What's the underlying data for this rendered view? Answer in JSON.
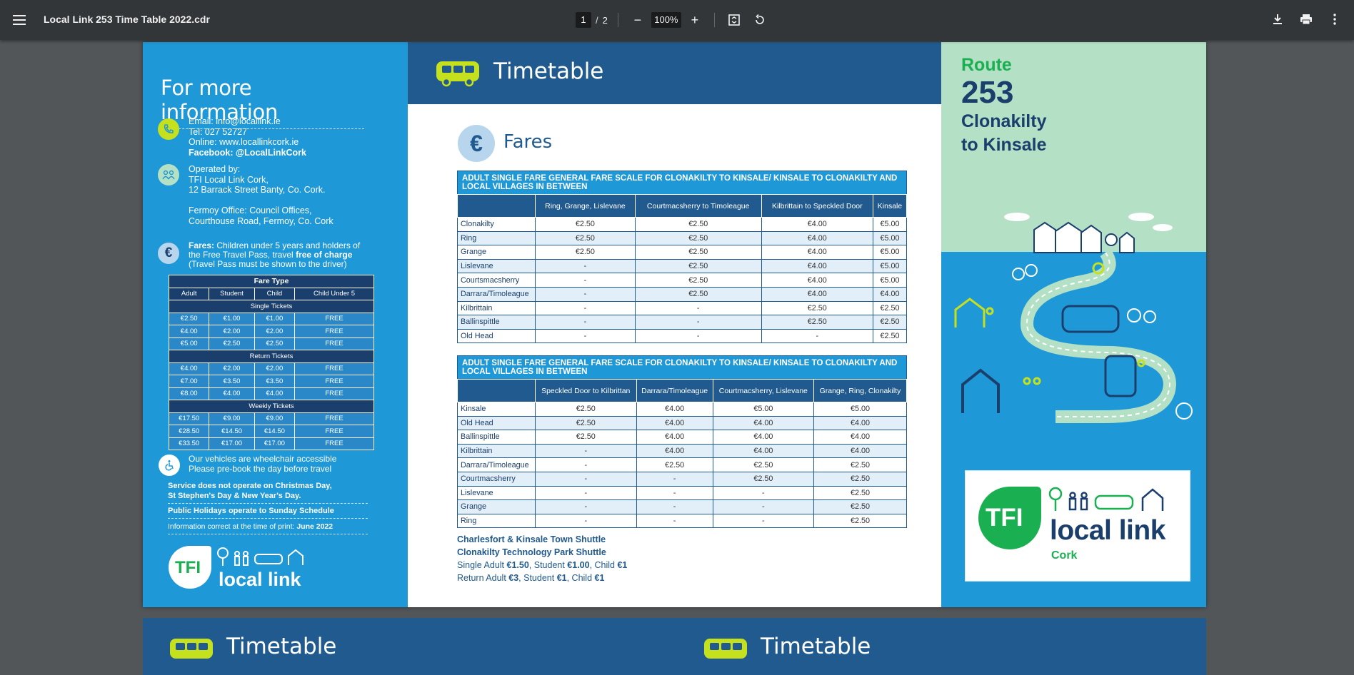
{
  "toolbar": {
    "title": "Local Link 253 Time Table 2022.cdr",
    "page_current": "1",
    "page_total": "2",
    "zoom": "100%"
  },
  "left": {
    "heading": "For more information",
    "contact": [
      "Email: info@locallink.ie",
      "Tel:  027 52727",
      "Online: www.locallinkcork.ie",
      "Facebook: @LocalLinkCork"
    ],
    "operated": [
      "Operated by:",
      "TFI Local Link Cork,",
      "12 Barrack Street Banty, Co. Cork.",
      "",
      "Fermoy Office: Council Offices,",
      "Courthouse Road, Fermoy, Co. Cork"
    ],
    "fares_label": "Fares:",
    "fares_text": " Children under 5 years and holders of the Free Travel Pass, travel ",
    "fares_bold": "free of charge",
    "fares_tail": " (Travel Pass must be shown to the driver)",
    "fare_type": "Fare Type",
    "fare_cols": [
      "Adult",
      "Student",
      "Child",
      "Child Under 5"
    ],
    "sections": [
      {
        "name": "Single Tickets",
        "rows": [
          [
            "€2.50",
            "€1.00",
            "€1.00",
            "FREE"
          ],
          [
            "€4.00",
            "€2.00",
            "€2.00",
            "FREE"
          ],
          [
            "€5.00",
            "€2.50",
            "€2.50",
            "FREE"
          ]
        ]
      },
      {
        "name": "Return Tickets",
        "rows": [
          [
            "€4.00",
            "€2.00",
            "€2.00",
            "FREE"
          ],
          [
            "€7.00",
            "€3.50",
            "€3.50",
            "FREE"
          ],
          [
            "€8.00",
            "€4.00",
            "€4.00",
            "FREE"
          ]
        ]
      },
      {
        "name": "Weekly Tickets",
        "rows": [
          [
            "€17.50",
            "€9.00",
            "€9.00",
            "FREE"
          ],
          [
            "€28.50",
            "€14.50",
            "€14.50",
            "FREE"
          ],
          [
            "€33.50",
            "€17.00",
            "€17.00",
            "FREE"
          ]
        ]
      }
    ],
    "wheelchair": [
      "Our vehicles are wheelchair accessible",
      "Please pre-book the day before travel"
    ],
    "note1": [
      "Service does not operate on Christmas Day,",
      "St Stephen's Day & New Year's Day."
    ],
    "note2": "Public Holidays operate to Sunday Schedule",
    "note3_pre": "Information correct at the time of print: ",
    "note3_bold": "June 2022",
    "logo_tfi": "TFI",
    "logo_text": "local link"
  },
  "main": {
    "header_title": "Timetable",
    "fares_title": "Fares",
    "euro_symbol": "€",
    "table1": {
      "title": "ADULT SINGLE FARE GENERAL FARE SCALE FOR CLONAKILTY TO KINSALE/ KINSALE TO CLONAKILTY AND LOCAL VILLAGES IN BETWEEN",
      "cols": [
        "Ring, Grange, Lislevane",
        "Courtmacsherry to Timoleague",
        "Kilbrittain to Speckled Door",
        "Kinsale"
      ],
      "rows": [
        [
          "Clonakilty",
          "€2.50",
          "€2.50",
          "€4.00",
          "€5.00"
        ],
        [
          "Ring",
          "€2.50",
          "€2.50",
          "€4.00",
          "€5.00"
        ],
        [
          "Grange",
          "€2.50",
          "€2.50",
          "€4.00",
          "€5.00"
        ],
        [
          "Lislevane",
          "-",
          "€2.50",
          "€4.00",
          "€5.00"
        ],
        [
          "Courtsmacsherry",
          "-",
          "€2.50",
          "€4.00",
          "€5.00"
        ],
        [
          "Darrara/Timoleague",
          "-",
          "€2.50",
          "€4.00",
          "€4.00"
        ],
        [
          "Kilbrittain",
          "-",
          "-",
          "€2.50",
          "€2.50"
        ],
        [
          "Ballinspittle",
          "-",
          "-",
          "€2.50",
          "€2.50"
        ],
        [
          "Old Head",
          "-",
          "-",
          "-",
          "€2.50"
        ]
      ]
    },
    "table2": {
      "title": "ADULT SINGLE FARE GENERAL FARE SCALE FOR CLONAKILTY TO KINSALE/ KINSALE TO CLONAKILTY AND LOCAL VILLAGES IN BETWEEN",
      "cols": [
        "Speckled Door to Kilbrittan",
        "Darrara/Timoleague",
        "Courtmacsherry, Lislevane",
        "Grange, Ring, Clonakilty"
      ],
      "rows": [
        [
          "Kinsale",
          "€2.50",
          "€4.00",
          "€5.00",
          "€5.00"
        ],
        [
          "Old Head",
          "€2.50",
          "€4.00",
          "€4.00",
          "€4.00"
        ],
        [
          "Ballinspittle",
          "€2.50",
          "€4.00",
          "€4.00",
          "€4.00"
        ],
        [
          "Kilbrittain",
          "-",
          "€4.00",
          "€4.00",
          "€4.00"
        ],
        [
          "Darrara/Timoleague",
          "-",
          "€2.50",
          "€2.50",
          "€2.50"
        ],
        [
          "Courtmacsherry",
          "-",
          "-",
          "€2.50",
          "€2.50"
        ],
        [
          "Lislevane",
          "-",
          "-",
          "-",
          "€2.50"
        ],
        [
          "Grange",
          "-",
          "-",
          "-",
          "€2.50"
        ],
        [
          "Ring",
          "-",
          "-",
          "-",
          "€2.50"
        ]
      ]
    },
    "shuttle1": "Charlesfort & Kinsale Town Shuttle",
    "shuttle2": "Clonakilty Technology Park Shuttle",
    "single_pre": "Single Adult ",
    "single_a": "€1.50",
    "single_mid": ", Student ",
    "single_s": "€1.00",
    "single_mid2": ", Child ",
    "single_c": "€1",
    "return_pre": "Return Adult ",
    "return_a": "€3",
    "return_mid": ", Student ",
    "return_s": "€1",
    "return_mid2": ", Child ",
    "return_c": "€1"
  },
  "right": {
    "route_label": "Route",
    "route_number": "253",
    "route_from": "Clonakilty",
    "route_to": "to Kinsale",
    "logo_tfi": "TFI",
    "logo_text": "local link",
    "logo_sub": "Cork"
  },
  "page2": {
    "left_title": "Timetable",
    "right_title": "Timetable"
  }
}
